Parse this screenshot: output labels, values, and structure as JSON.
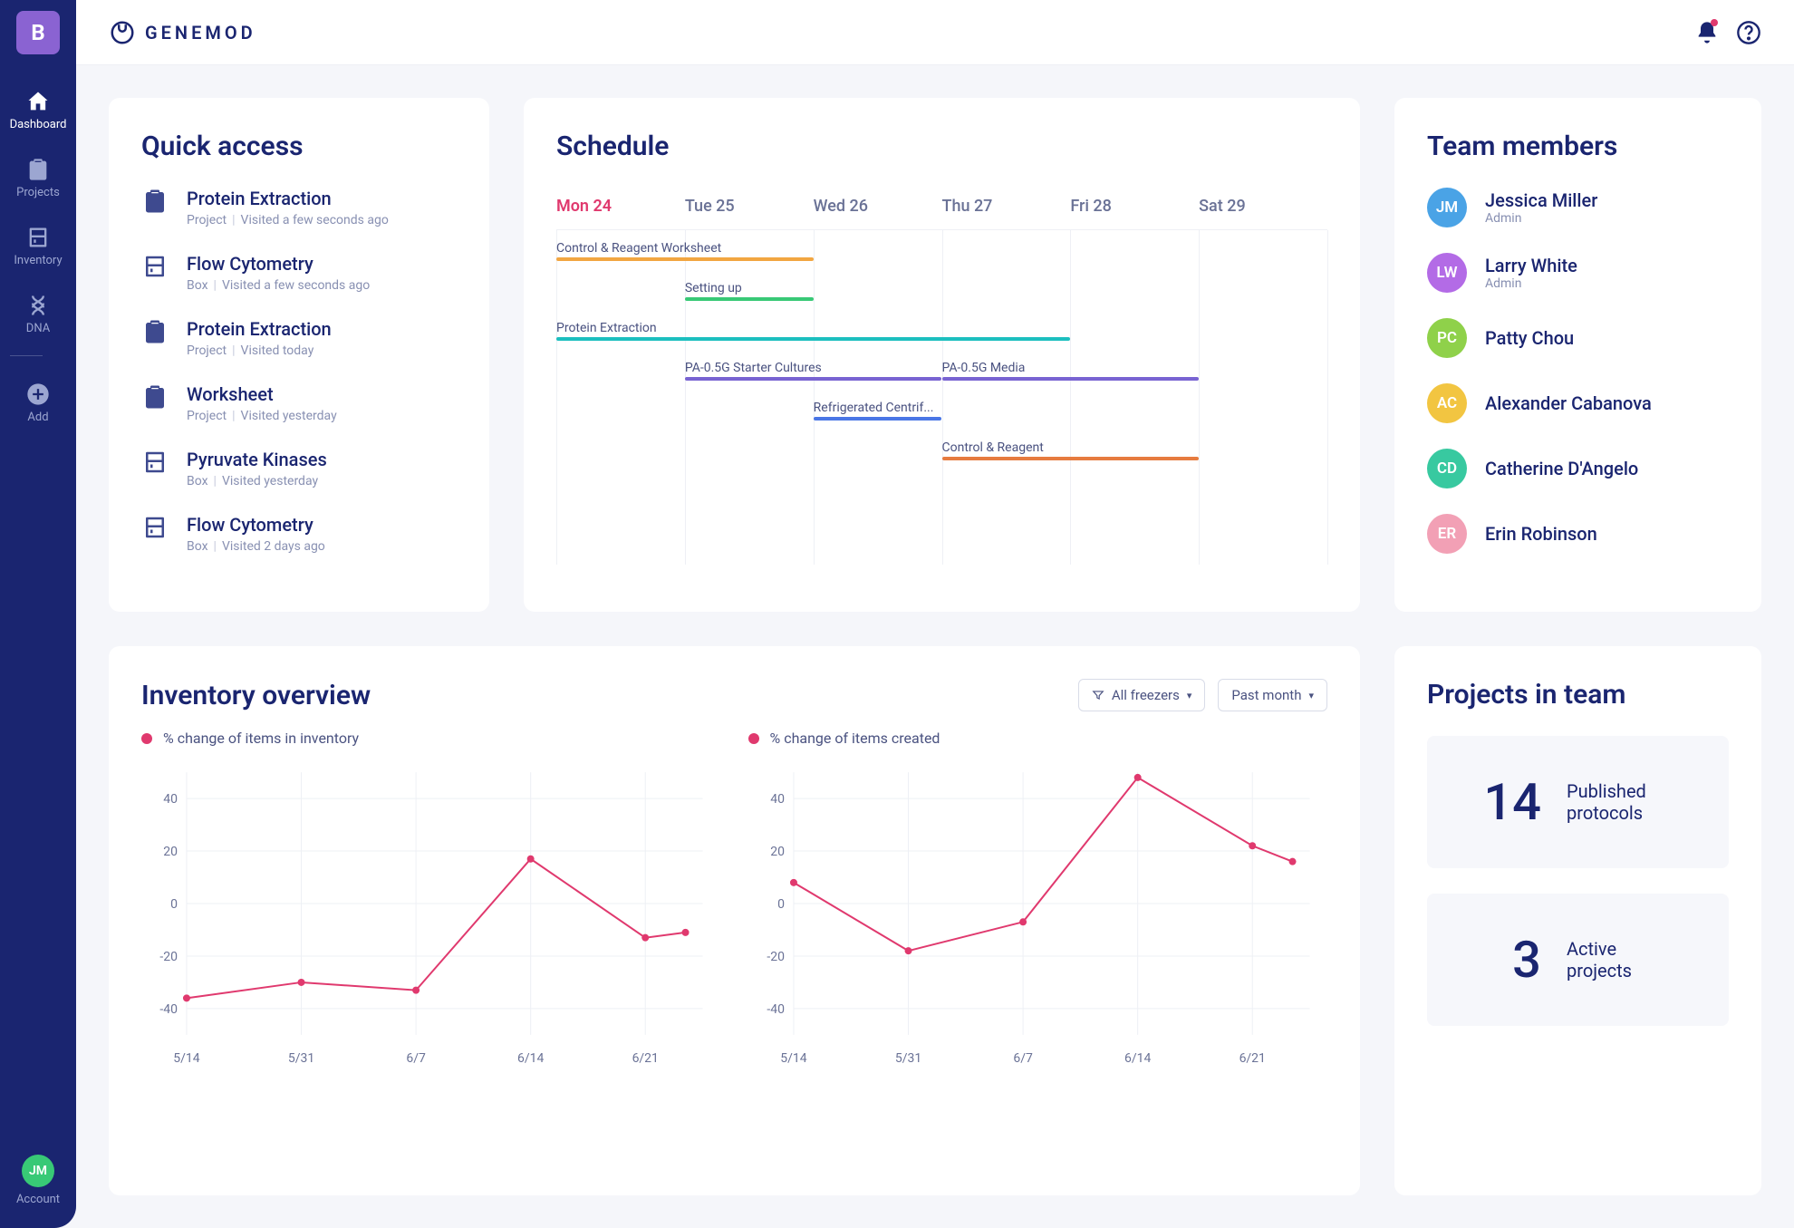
{
  "brand": {
    "name": "GENEMOD",
    "logo_letter": "B"
  },
  "sidebar": {
    "items": [
      {
        "label": "Dashboard",
        "icon": "home"
      },
      {
        "label": "Projects",
        "icon": "clipboard"
      },
      {
        "label": "Inventory",
        "icon": "freezer"
      },
      {
        "label": "DNA",
        "icon": "dna"
      },
      {
        "label": "Add",
        "icon": "plus"
      }
    ],
    "account": {
      "label": "Account",
      "initials": "JM"
    }
  },
  "quick_access": {
    "title": "Quick access",
    "items": [
      {
        "icon": "clipboard",
        "title": "Protein Extraction",
        "type": "Project",
        "meta": "Visited a few seconds ago"
      },
      {
        "icon": "freezer",
        "title": "Flow Cytometry",
        "type": "Box",
        "meta": "Visited a few seconds ago"
      },
      {
        "icon": "clipboard",
        "title": "Protein Extraction",
        "type": "Project",
        "meta": "Visited today"
      },
      {
        "icon": "clipboard",
        "title": "Worksheet",
        "type": "Project",
        "meta": "Visited yesterday"
      },
      {
        "icon": "freezer",
        "title": "Pyruvate Kinases",
        "type": "Box",
        "meta": "Visited yesterday"
      },
      {
        "icon": "freezer",
        "title": "Flow Cytometry",
        "type": "Box",
        "meta": "Visited 2 days ago"
      }
    ]
  },
  "schedule": {
    "title": "Schedule",
    "days": [
      "Mon 24",
      "Tue 25",
      "Wed 26",
      "Thu 27",
      "Fri 28",
      "Sat 29"
    ],
    "active_day": 0,
    "bars": [
      {
        "label": "Control & Reagent Worksheet",
        "start": 0,
        "end": 2,
        "row": 0,
        "color": "#f2a641"
      },
      {
        "label": "Setting up",
        "start": 1,
        "end": 2,
        "row": 1,
        "color": "#38c976"
      },
      {
        "label": "Protein Extraction",
        "start": 0,
        "end": 4,
        "row": 2,
        "color": "#1cbfbf"
      },
      {
        "label": "PA-0.5G Starter Cultures",
        "start": 1,
        "end": 3,
        "row": 3,
        "color": "#7863d2"
      },
      {
        "label": "PA-0.5G Media",
        "start": 3,
        "end": 5,
        "row": 3,
        "color": "#7863d2"
      },
      {
        "label": "Refrigerated Centrif...",
        "start": 2,
        "end": 3,
        "row": 4,
        "color": "#4a76e6"
      },
      {
        "label": "Control & Reagent",
        "start": 3,
        "end": 5,
        "row": 5,
        "color": "#e67b3f"
      }
    ]
  },
  "team": {
    "title": "Team members",
    "members": [
      {
        "initials": "JM",
        "name": "Jessica Miller",
        "role": "Admin",
        "color": "#4aa3e6"
      },
      {
        "initials": "LW",
        "name": "Larry White",
        "role": "Admin",
        "color": "#b36be6"
      },
      {
        "initials": "PC",
        "name": "Patty Chou",
        "role": "",
        "color": "#8fd14a"
      },
      {
        "initials": "AC",
        "name": "Alexander Cabanova",
        "role": "",
        "color": "#f2c541"
      },
      {
        "initials": "CD",
        "name": "Catherine D'Angelo",
        "role": "",
        "color": "#38c9a0"
      },
      {
        "initials": "ER",
        "name": "Erin Robinson",
        "role": "",
        "color": "#f2a0b5"
      }
    ]
  },
  "inventory": {
    "title": "Inventory overview",
    "filter1": "All freezers",
    "filter2": "Past month",
    "charts": [
      {
        "legend": "% change of items in inventory"
      },
      {
        "legend": "% change of items created"
      }
    ]
  },
  "projects": {
    "title": "Projects in team",
    "stats": [
      {
        "value": "14",
        "label": "Published protocols"
      },
      {
        "value": "3",
        "label": "Active projects"
      }
    ]
  },
  "chart_data": [
    {
      "type": "line",
      "title": "% change of items in inventory",
      "x": [
        "5/14",
        "5/31",
        "6/7",
        "6/14",
        "6/21"
      ],
      "y_ticks": [
        -40,
        -20,
        0,
        20,
        40
      ],
      "series": [
        {
          "name": "% change of items in inventory",
          "color": "#e0396e",
          "values": [
            -36,
            -30,
            -33,
            17,
            -13,
            -11
          ],
          "x_positions": [
            0,
            1,
            2,
            3,
            4,
            4.35
          ]
        }
      ],
      "ylim": [
        -50,
        50
      ]
    },
    {
      "type": "line",
      "title": "% change of items created",
      "x": [
        "5/14",
        "5/31",
        "6/7",
        "6/14",
        "6/21"
      ],
      "y_ticks": [
        -40,
        -20,
        0,
        20,
        40
      ],
      "series": [
        {
          "name": "% change of items created",
          "color": "#e0396e",
          "values": [
            8,
            -18,
            -7,
            48,
            22,
            16
          ],
          "x_positions": [
            0,
            1,
            2,
            3,
            4,
            4.35
          ]
        }
      ],
      "ylim": [
        -50,
        50
      ]
    }
  ]
}
